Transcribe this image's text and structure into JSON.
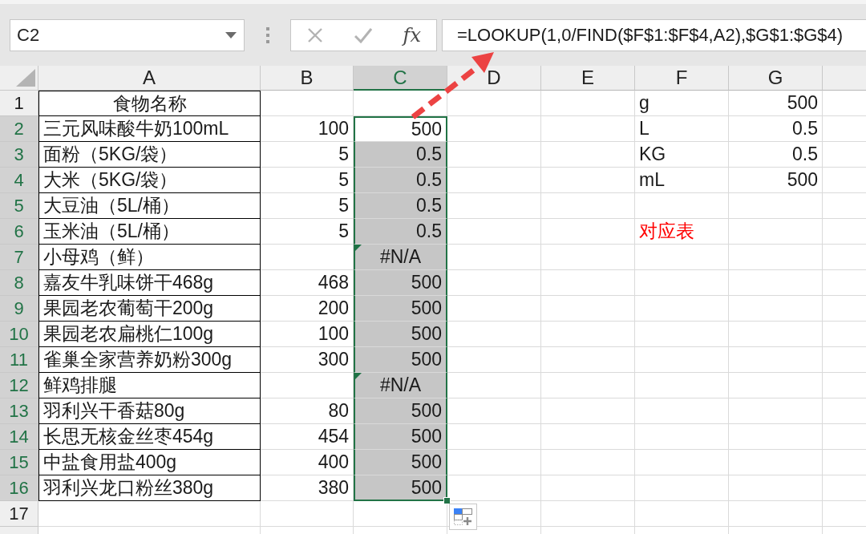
{
  "name_box": {
    "value": "C2"
  },
  "formula_buttons": [
    {
      "kind": "cancel",
      "disabled": true
    },
    {
      "kind": "enter",
      "disabled": true
    },
    {
      "kind": "function",
      "label": "fx",
      "disabled": false
    }
  ],
  "formula_bar": {
    "value": "=LOOKUP(1,0/FIND($F$1:$F$4,A2),$G$1:$G$4)"
  },
  "sheet": {
    "columns": [
      {
        "label": "A",
        "selected": false
      },
      {
        "label": "B",
        "selected": false
      },
      {
        "label": "C",
        "selected": true
      },
      {
        "label": "D",
        "selected": false
      },
      {
        "label": "E",
        "selected": false
      },
      {
        "label": "F",
        "selected": false
      },
      {
        "label": "G",
        "selected": false
      }
    ],
    "rows": [
      {
        "header": "1",
        "selected": false,
        "kind": "header",
        "a": "食物名称",
        "f": "g",
        "g": "500"
      },
      {
        "header": "2",
        "selected": true,
        "kind": "item",
        "a": "三元风味酸牛奶100mL",
        "b": "100",
        "c": {
          "value": "500",
          "selected": true,
          "active": true,
          "error_flag": false
        },
        "f": "L",
        "g": "0.5"
      },
      {
        "header": "3",
        "selected": true,
        "kind": "item",
        "a": "面粉（5KG/袋）",
        "b": "5",
        "c": {
          "value": "0.5",
          "selected": true,
          "active": false,
          "error_flag": false
        },
        "f": "KG",
        "g": "0.5"
      },
      {
        "header": "4",
        "selected": true,
        "kind": "item",
        "a": "大米（5KG/袋）",
        "b": "5",
        "c": {
          "value": "0.5",
          "selected": true,
          "active": false,
          "error_flag": false
        },
        "f": "mL",
        "g": "500"
      },
      {
        "header": "5",
        "selected": true,
        "kind": "item",
        "a": "大豆油（5L/桶）",
        "b": "5",
        "c": {
          "value": "0.5",
          "selected": true,
          "active": false,
          "error_flag": false
        }
      },
      {
        "header": "6",
        "selected": true,
        "kind": "item",
        "a": "玉米油（5L/桶）",
        "b": "5",
        "c": {
          "value": "0.5",
          "selected": true,
          "active": false,
          "error_flag": false
        },
        "f": {
          "text": "对应表",
          "color": "#ff0000"
        }
      },
      {
        "header": "7",
        "selected": true,
        "kind": "item",
        "a": "小母鸡（鲜）",
        "c": {
          "value": "#N/A",
          "selected": true,
          "active": false,
          "error_flag": true
        }
      },
      {
        "header": "8",
        "selected": true,
        "kind": "item",
        "a": "嘉友牛乳味饼干468g",
        "b": "468",
        "c": {
          "value": "500",
          "selected": true,
          "active": false,
          "error_flag": false
        }
      },
      {
        "header": "9",
        "selected": true,
        "kind": "item",
        "a": "果园老农葡萄干200g",
        "b": "200",
        "c": {
          "value": "500",
          "selected": true,
          "active": false,
          "error_flag": false
        }
      },
      {
        "header": "10",
        "selected": true,
        "kind": "item",
        "a": "果园老农扁桃仁100g",
        "b": "100",
        "c": {
          "value": "500",
          "selected": true,
          "active": false,
          "error_flag": false
        }
      },
      {
        "header": "11",
        "selected": true,
        "kind": "item",
        "a": "雀巢全家营养奶粉300g",
        "b": "300",
        "c": {
          "value": "500",
          "selected": true,
          "active": false,
          "error_flag": false
        }
      },
      {
        "header": "12",
        "selected": true,
        "kind": "item",
        "a": "鲜鸡排腿",
        "c": {
          "value": "#N/A",
          "selected": true,
          "active": false,
          "error_flag": true
        }
      },
      {
        "header": "13",
        "selected": true,
        "kind": "item",
        "a": "羽利兴干香菇80g",
        "b": "80",
        "c": {
          "value": "500",
          "selected": true,
          "active": false,
          "error_flag": false
        }
      },
      {
        "header": "14",
        "selected": true,
        "kind": "item",
        "a": "长思无核金丝枣454g",
        "b": "454",
        "c": {
          "value": "500",
          "selected": true,
          "active": false,
          "error_flag": false
        }
      },
      {
        "header": "15",
        "selected": true,
        "kind": "item",
        "a": "中盐食用盐400g",
        "b": "400",
        "c": {
          "value": "500",
          "selected": true,
          "active": false,
          "error_flag": false
        }
      },
      {
        "header": "16",
        "selected": true,
        "kind": "item",
        "a": "羽利兴龙口粉丝380g",
        "b": "380",
        "c": {
          "value": "500",
          "selected": true,
          "active": false,
          "error_flag": false
        }
      },
      {
        "header": "17",
        "selected": false,
        "kind": "blank"
      }
    ]
  }
}
